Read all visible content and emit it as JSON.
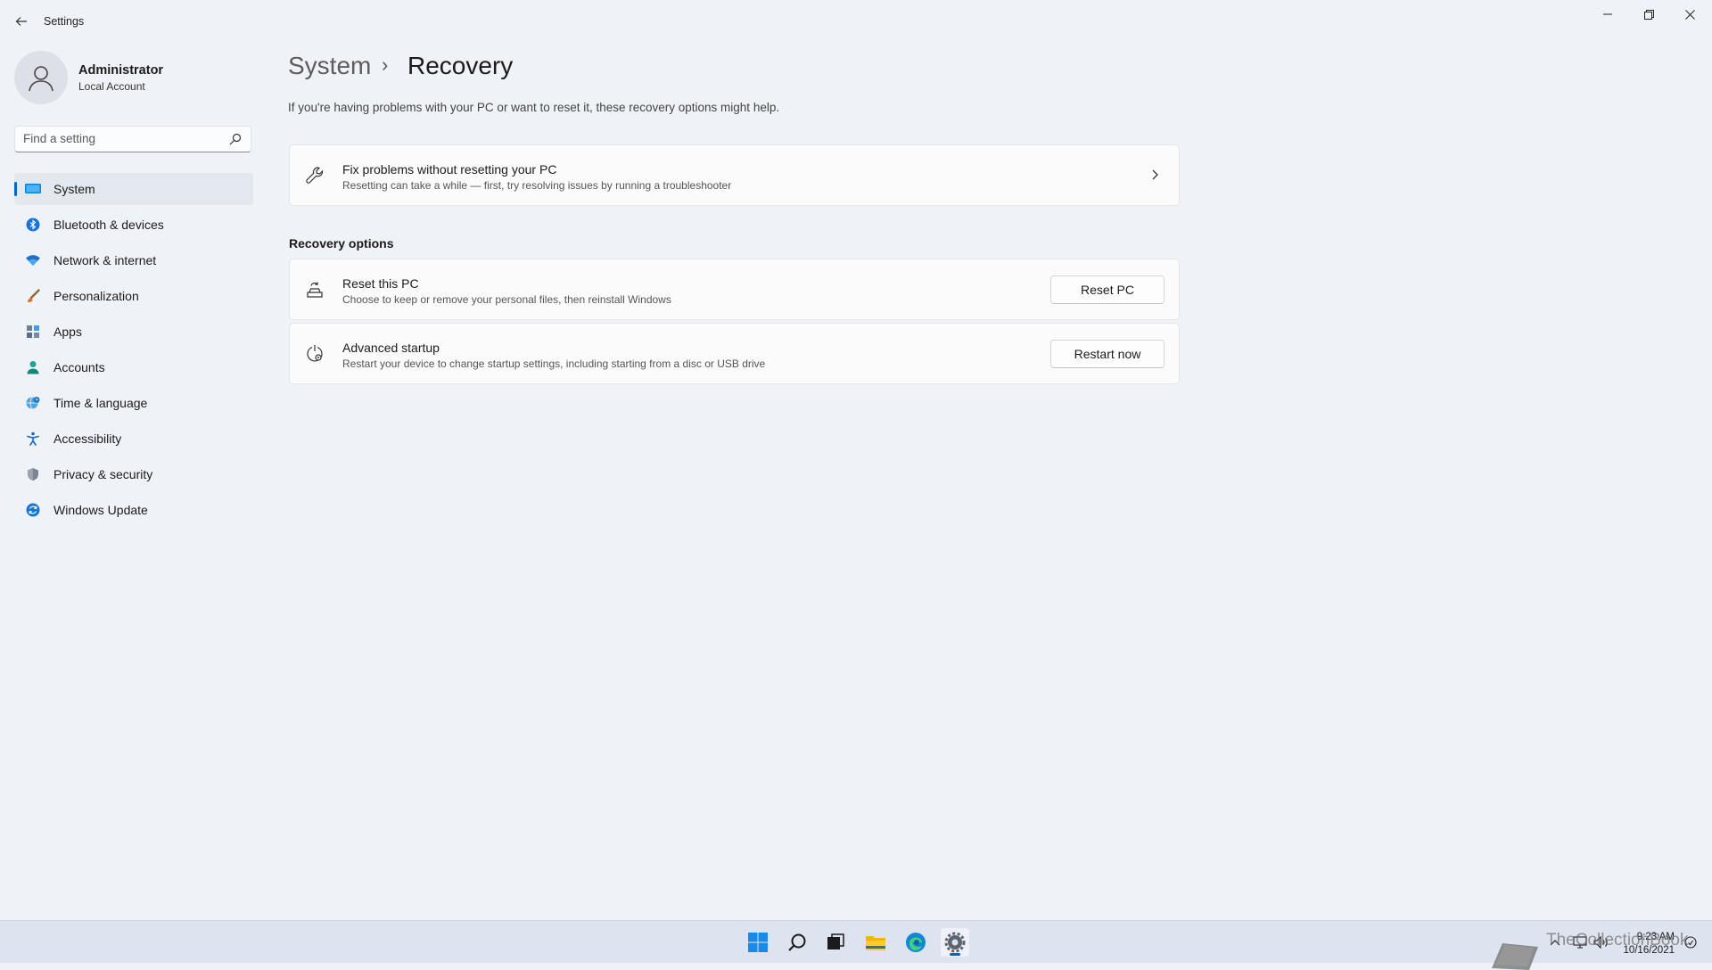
{
  "app": {
    "title": "Settings"
  },
  "window_controls": [
    "minimize",
    "restore",
    "close"
  ],
  "user": {
    "name": "Administrator",
    "account_type": "Local Account"
  },
  "search": {
    "placeholder": "Find a setting"
  },
  "sidebar": {
    "items": [
      {
        "label": "System",
        "icon": "system-display-icon",
        "selected": true
      },
      {
        "label": "Bluetooth & devices",
        "icon": "bluetooth-icon"
      },
      {
        "label": "Network & internet",
        "icon": "wifi-icon"
      },
      {
        "label": "Personalization",
        "icon": "brush-icon"
      },
      {
        "label": "Apps",
        "icon": "apps-icon"
      },
      {
        "label": "Accounts",
        "icon": "accounts-icon"
      },
      {
        "label": "Time & language",
        "icon": "globe-clock-icon"
      },
      {
        "label": "Accessibility",
        "icon": "accessibility-icon"
      },
      {
        "label": "Privacy & security",
        "icon": "shield-icon"
      },
      {
        "label": "Windows Update",
        "icon": "update-icon"
      }
    ]
  },
  "breadcrumb": {
    "parent": "System",
    "separator": "›",
    "current": "Recovery"
  },
  "description": "If you're having problems with your PC or want to reset it, these recovery options might help.",
  "fix_card": {
    "title": "Fix problems without resetting your PC",
    "subtitle": "Resetting can take a while — first, try resolving issues by running a troubleshooter"
  },
  "recovery_options": {
    "header": "Recovery options",
    "items": [
      {
        "title": "Reset this PC",
        "subtitle": "Choose to keep or remove your personal files, then reinstall Windows",
        "button": "Reset PC",
        "icon": "reset-pc-icon"
      },
      {
        "title": "Advanced startup",
        "subtitle": "Restart your device to change startup settings, including starting from a disc or USB drive",
        "button": "Restart now",
        "icon": "advanced-startup-icon"
      }
    ]
  },
  "taskbar": {
    "apps": [
      "start-icon",
      "search-icon",
      "task-view-icon",
      "file-explorer-icon",
      "edge-icon",
      "settings-icon"
    ],
    "active": "settings-icon",
    "clock_time": "9:23 AM",
    "clock_date": "10/16/2021"
  },
  "watermark": {
    "text": "TheCollectionBook"
  },
  "colors": {
    "accent": "#0067c0",
    "background": "#eff2f7",
    "card": "#fbfbfc"
  }
}
